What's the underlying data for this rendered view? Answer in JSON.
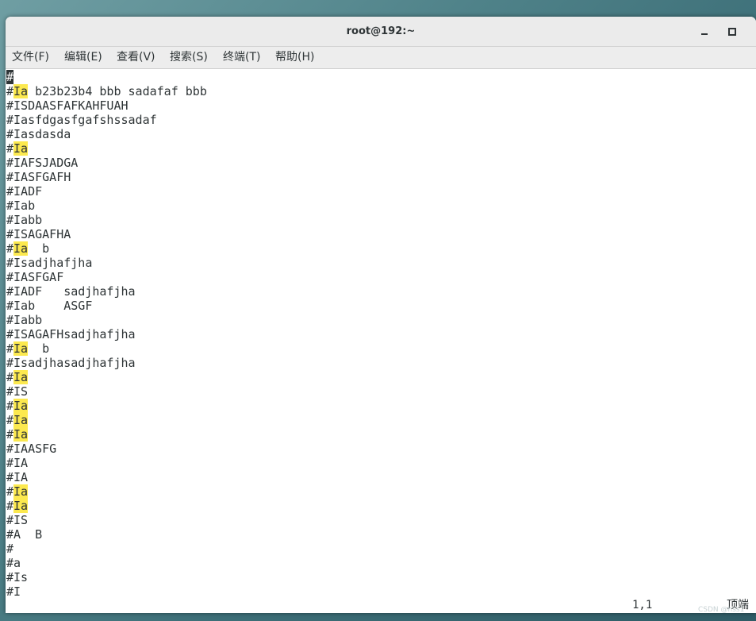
{
  "window": {
    "title": "root@192:~",
    "minimize_icon": "minimize-icon",
    "maximize_icon": "maximize-icon"
  },
  "menu": [
    {
      "label": "文件(F)"
    },
    {
      "label": "编辑(E)"
    },
    {
      "label": "查看(V)"
    },
    {
      "label": "搜索(S)"
    },
    {
      "label": "终端(T)"
    },
    {
      "label": "帮助(H)"
    }
  ],
  "editor": {
    "highlight_color": "#fce94f",
    "lines": [
      [
        {
          "t": "#",
          "cursor": true
        }
      ],
      [
        {
          "t": "#"
        },
        {
          "t": "Ia",
          "hl": true
        },
        {
          "t": " b23b23b4 bbb sadafaf bbb"
        }
      ],
      [
        {
          "t": "#ISDAASFAFKAHFUAH"
        }
      ],
      [
        {
          "t": "#Iasfdgasfgafshssadaf"
        }
      ],
      [
        {
          "t": "#Iasdasda"
        }
      ],
      [
        {
          "t": "#"
        },
        {
          "t": "Ia",
          "hl": true
        }
      ],
      [
        {
          "t": "#IAFSJADGA"
        }
      ],
      [
        {
          "t": "#IASFGAFH"
        }
      ],
      [
        {
          "t": "#IADF"
        }
      ],
      [
        {
          "t": "#Iab"
        }
      ],
      [
        {
          "t": "#Iabb"
        }
      ],
      [
        {
          "t": "#ISAGAFHA"
        }
      ],
      [
        {
          "t": "#"
        },
        {
          "t": "Ia",
          "hl": true
        },
        {
          "t": "  b"
        }
      ],
      [
        {
          "t": "#Isadjhafjha"
        }
      ],
      [
        {
          "t": "#IASFGAF"
        }
      ],
      [
        {
          "t": "#IADF   sadjhafjha"
        }
      ],
      [
        {
          "t": "#Iab    ASGF"
        }
      ],
      [
        {
          "t": "#Iabb"
        }
      ],
      [
        {
          "t": "#ISAGAFHsadjhafjha"
        }
      ],
      [
        {
          "t": "#"
        },
        {
          "t": "Ia",
          "hl": true
        },
        {
          "t": "  b"
        }
      ],
      [
        {
          "t": "#Isadjhasadjhafjha"
        }
      ],
      [
        {
          "t": "#"
        },
        {
          "t": "Ia",
          "hl": true
        }
      ],
      [
        {
          "t": "#IS"
        }
      ],
      [
        {
          "t": "#"
        },
        {
          "t": "Ia",
          "hl": true
        }
      ],
      [
        {
          "t": "#"
        },
        {
          "t": "Ia",
          "hl": true
        }
      ],
      [
        {
          "t": "#"
        },
        {
          "t": "Ia",
          "hl": true
        }
      ],
      [
        {
          "t": "#IAASFG"
        }
      ],
      [
        {
          "t": "#IA"
        }
      ],
      [
        {
          "t": "#IA"
        }
      ],
      [
        {
          "t": "#"
        },
        {
          "t": "Ia",
          "hl": true
        }
      ],
      [
        {
          "t": "#"
        },
        {
          "t": "Ia",
          "hl": true
        }
      ],
      [
        {
          "t": "#IS"
        }
      ],
      [
        {
          "t": "#A  B"
        }
      ],
      [
        {
          "t": "#"
        }
      ],
      [
        {
          "t": "#a"
        }
      ],
      [
        {
          "t": "#Is"
        }
      ],
      [
        {
          "t": "#I"
        }
      ]
    ]
  },
  "status": {
    "position": "1,1",
    "scroll": "顶端"
  },
  "watermark": "CSDN @hss1"
}
